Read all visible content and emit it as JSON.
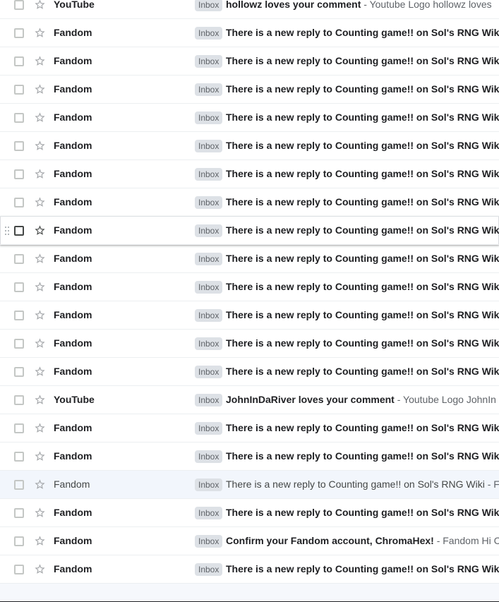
{
  "inbox_label": "Inbox",
  "colors": {
    "unread_text": "#202124",
    "read_row_bg": "#f2f6fc",
    "badge_bg": "#dde1e6"
  },
  "emails": [
    {
      "sender": "YouTube",
      "subject": "hollowz loves your comment",
      "snippet": " - Youtube Logo hollowz loves",
      "read": false
    },
    {
      "sender": "Fandom",
      "subject": "There is a new reply to Counting game!! on Sol's RNG Wiki",
      "snippet": "",
      "read": false
    },
    {
      "sender": "Fandom",
      "subject": "There is a new reply to Counting game!! on Sol's RNG Wiki",
      "snippet": "",
      "read": false
    },
    {
      "sender": "Fandom",
      "subject": "There is a new reply to Counting game!! on Sol's RNG Wiki",
      "snippet": "",
      "read": false
    },
    {
      "sender": "Fandom",
      "subject": "There is a new reply to Counting game!! on Sol's RNG Wiki",
      "snippet": "",
      "read": false
    },
    {
      "sender": "Fandom",
      "subject": "There is a new reply to Counting game!! on Sol's RNG Wiki",
      "snippet": "",
      "read": false
    },
    {
      "sender": "Fandom",
      "subject": "There is a new reply to Counting game!! on Sol's RNG Wiki",
      "snippet": "",
      "read": false
    },
    {
      "sender": "Fandom",
      "subject": "There is a new reply to Counting game!! on Sol's RNG Wiki",
      "snippet": "",
      "read": false
    },
    {
      "sender": "Fandom",
      "subject": "There is a new reply to Counting game!! on Sol's RNG Wiki",
      "snippet": "",
      "read": false,
      "hover": true
    },
    {
      "sender": "Fandom",
      "subject": "There is a new reply to Counting game!! on Sol's RNG Wiki",
      "snippet": "",
      "read": false
    },
    {
      "sender": "Fandom",
      "subject": "There is a new reply to Counting game!! on Sol's RNG Wiki",
      "snippet": "",
      "read": false
    },
    {
      "sender": "Fandom",
      "subject": "There is a new reply to Counting game!! on Sol's RNG Wiki",
      "snippet": "",
      "read": false
    },
    {
      "sender": "Fandom",
      "subject": "There is a new reply to Counting game!! on Sol's RNG Wiki",
      "snippet": "",
      "read": false
    },
    {
      "sender": "Fandom",
      "subject": "There is a new reply to Counting game!! on Sol's RNG Wiki",
      "snippet": "",
      "read": false
    },
    {
      "sender": "YouTube",
      "subject": "JohnInDaRiver loves your comment",
      "snippet": " - Youtube Logo JohnIn",
      "read": false
    },
    {
      "sender": "Fandom",
      "subject": "There is a new reply to Counting game!! on Sol's RNG Wiki",
      "snippet": "",
      "read": false
    },
    {
      "sender": "Fandom",
      "subject": "There is a new reply to Counting game!! on Sol's RNG Wiki",
      "snippet": "",
      "read": false
    },
    {
      "sender": "Fandom",
      "subject": "There is a new reply to Counting game!! on Sol's RNG Wiki",
      "snippet": " - Fa",
      "read": true
    },
    {
      "sender": "Fandom",
      "subject": "There is a new reply to Counting game!! on Sol's RNG Wiki",
      "snippet": "",
      "read": false
    },
    {
      "sender": "Fandom",
      "subject": "Confirm your Fandom account, ChromaHex!",
      "snippet": " - Fandom Hi C",
      "read": false
    },
    {
      "sender": "Fandom",
      "subject": "There is a new reply to Counting game!! on Sol's RNG Wiki",
      "snippet": "",
      "read": false
    }
  ]
}
